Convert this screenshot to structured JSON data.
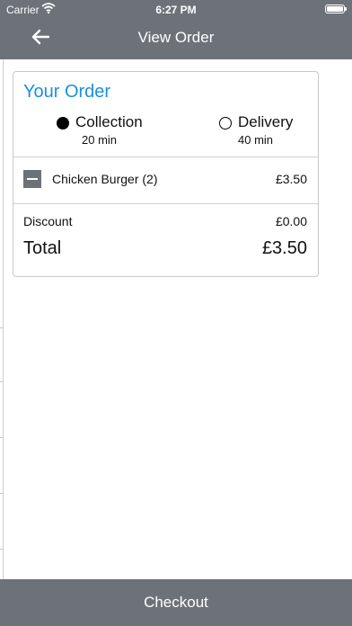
{
  "status_bar": {
    "carrier": "Carrier",
    "time": "6:27 PM"
  },
  "nav": {
    "title": "View Order",
    "back_icon": "arrow-left-icon"
  },
  "order": {
    "heading": "Your Order",
    "fulfillment": {
      "selected": "Collection",
      "options": [
        {
          "label": "Collection",
          "time": "20 min",
          "selected": true
        },
        {
          "label": "Delivery",
          "time": "40 min",
          "selected": false
        }
      ]
    },
    "items": [
      {
        "name": "Chicken Burger (2)",
        "price": "£3.50"
      }
    ],
    "discount": {
      "label": "Discount",
      "value": "£0.00"
    },
    "total": {
      "label": "Total",
      "value": "£3.50"
    }
  },
  "checkout": {
    "label": "Checkout"
  },
  "colors": {
    "bar_background": "#6d7278",
    "accent": "#1a8fe0"
  }
}
